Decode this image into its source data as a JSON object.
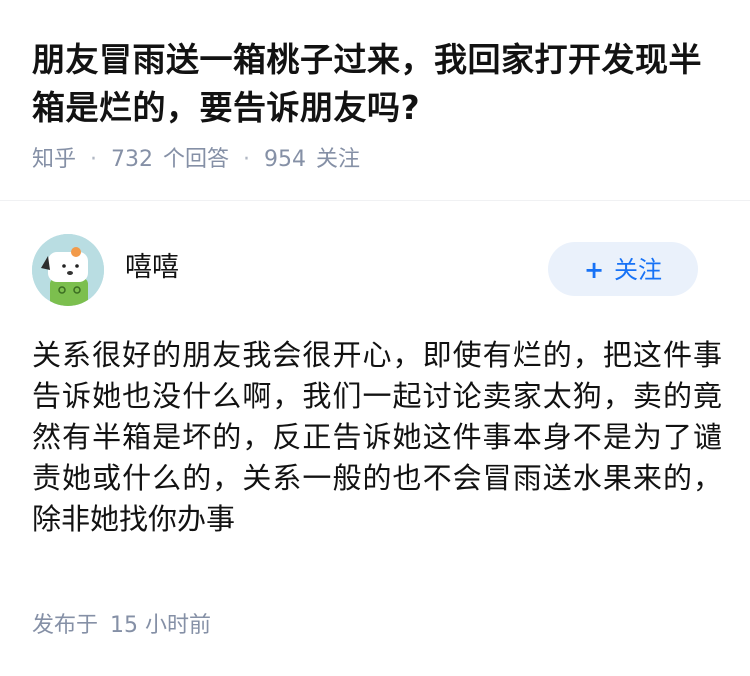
{
  "question": {
    "title": "朋友冒雨送一箱桃子过来，我回家打开发现半箱是烂的，要告诉朋友吗?",
    "source": "知乎",
    "answers_count": "732",
    "answers_label": "个回答",
    "followers_count": "954",
    "followers_label": "关注"
  },
  "author": {
    "name": "嘻嘻",
    "avatar_icon": "cartoon-dog-avatar",
    "follow_label": "关注",
    "follow_prefix": "+"
  },
  "answer": {
    "content": "关系很好的朋友我会很开心，即使有烂的，把这件事告诉她也没什么啊，我们一起讨论卖家太狗，卖的竟然有半箱是坏的，反正告诉她这件事本身不是为了谴责她或什么的，关系一般的也不会冒雨送水果来的，除非她找你办事",
    "published_label": "发布于",
    "published_time": "15 小时前"
  },
  "colors": {
    "title": "#121212",
    "meta": "#8590a6",
    "accent": "#1772f6",
    "follow_bg": "#eaf1fb"
  }
}
